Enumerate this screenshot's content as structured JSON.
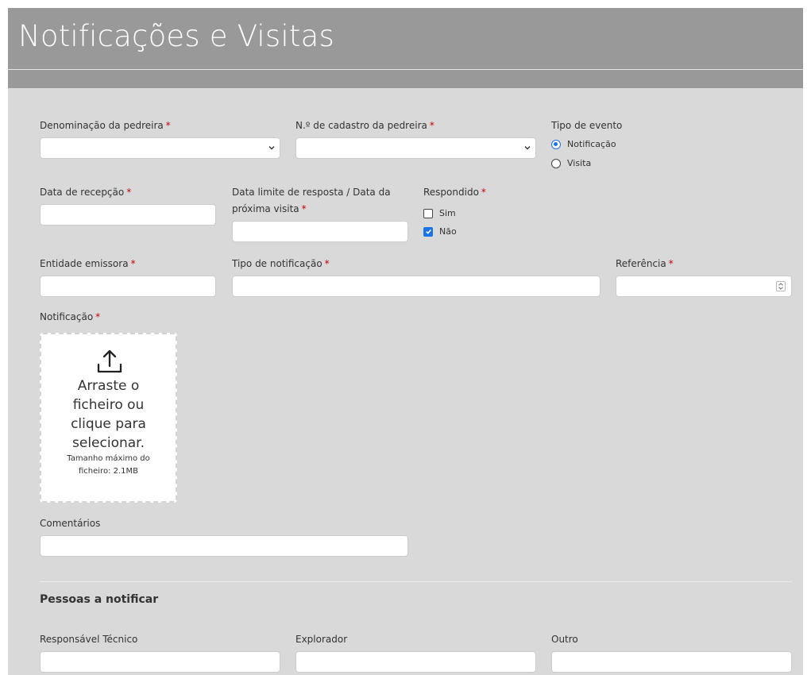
{
  "header": {
    "title": "Notificações e Visitas"
  },
  "form": {
    "denominacao": {
      "label": "Denominação da pedreira",
      "required": "*",
      "value": ""
    },
    "cadastro": {
      "label": "N.º de cadastro da pedreira",
      "required": "*",
      "value": ""
    },
    "tipo_evento": {
      "label": "Tipo de evento",
      "options": [
        {
          "label": "Notificação",
          "selected": true
        },
        {
          "label": "Visita",
          "selected": false
        }
      ]
    },
    "data_recepcao": {
      "label": "Data de recepção",
      "required": "*",
      "value": ""
    },
    "data_limite": {
      "label_line1": "Data limite de resposta / Data da",
      "label_line2": "próxima visita",
      "required": "*",
      "value": ""
    },
    "respondido": {
      "label": "Respondido",
      "required": "*",
      "options": [
        {
          "label": "Sim",
          "checked": false
        },
        {
          "label": "Não",
          "checked": true
        }
      ]
    },
    "entidade_emissora": {
      "label": "Entidade emissora",
      "required": "*",
      "value": ""
    },
    "tipo_notificacao": {
      "label": "Tipo de notificação",
      "required": "*",
      "value": ""
    },
    "referencia": {
      "label": "Referência",
      "required": "*",
      "value": ""
    },
    "notificacao": {
      "label": "Notificação",
      "required": "*",
      "dropzone_text": "Arraste o ficheiro ou clique para selecionar.",
      "dropzone_hint": "Tamanho máximo do ficheiro: 2.1MB"
    },
    "comentarios": {
      "label": "Comentários",
      "value": ""
    }
  },
  "pessoas": {
    "title": "Pessoas a notificar",
    "responsavel": {
      "label": "Responsável Técnico",
      "value": ""
    },
    "explorador": {
      "label": "Explorador",
      "value": ""
    },
    "outro": {
      "label": "Outro",
      "value": ""
    }
  },
  "icons": {
    "select_arrow": "chevron-down-icon",
    "upload": "upload-icon",
    "spinner": "spinner-icon"
  },
  "colors": {
    "header_bg": "#999999",
    "panel_bg": "#d9d9d9",
    "accent": "#1a73e8",
    "required": "#cc0000"
  }
}
